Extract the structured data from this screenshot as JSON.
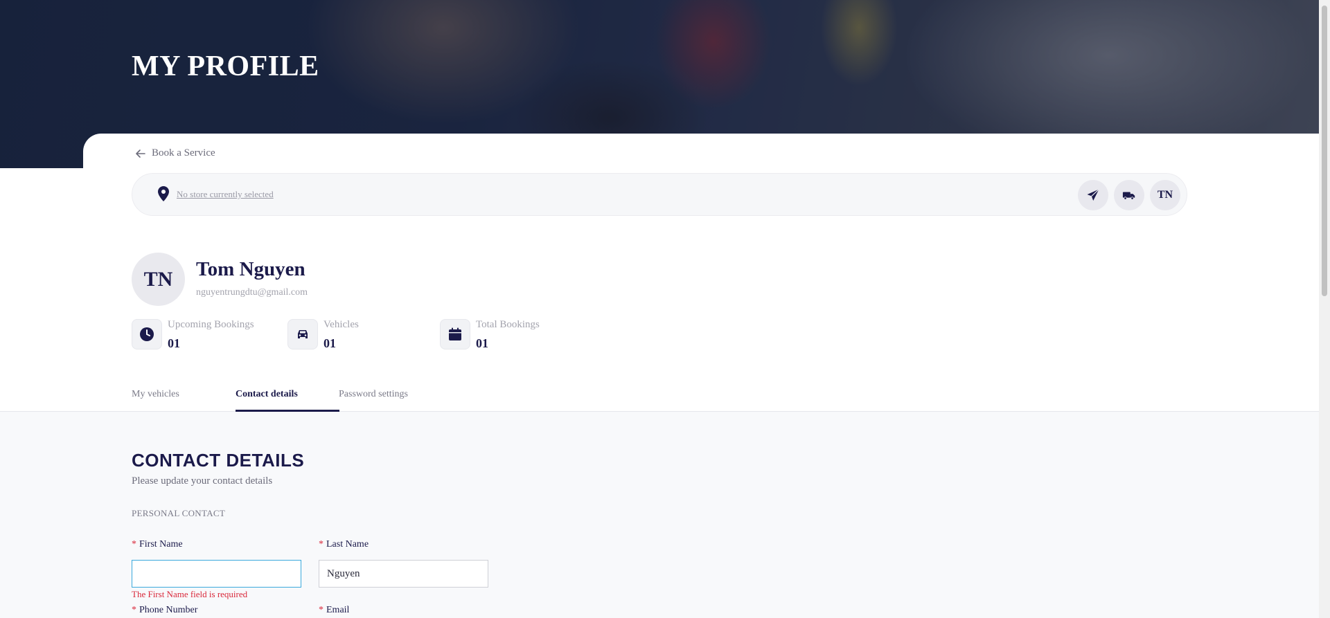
{
  "hero": {
    "title": "MY PROFILE"
  },
  "nav": {
    "back_label": "Book a Service"
  },
  "store_bar": {
    "store_text": "No store currently selected",
    "user_initials": "TN"
  },
  "profile": {
    "initials": "TN",
    "name": "Tom Nguyen",
    "email": "nguyentrungdtu@gmail.com",
    "stats": [
      {
        "label": "Upcoming Bookings",
        "value": "01",
        "icon": "clock-icon"
      },
      {
        "label": "Vehicles",
        "value": "01",
        "icon": "car-icon"
      },
      {
        "label": "Total Bookings",
        "value": "01",
        "icon": "calendar-icon"
      }
    ]
  },
  "tabs": [
    {
      "label": "My vehicles"
    },
    {
      "label": "Contact details",
      "active": true
    },
    {
      "label": "Password settings"
    }
  ],
  "contact": {
    "title": "CONTACT DETAILS",
    "subtitle": "Please update your contact details",
    "group_label": "PERSONAL CONTACT",
    "required_marker": "*",
    "first_name": {
      "label": "First Name",
      "value": "",
      "error": "The First Name field is required"
    },
    "last_name": {
      "label": "Last Name",
      "value": "Nguyen"
    },
    "phone": {
      "label": "Phone Number"
    },
    "email": {
      "label": "Email"
    }
  },
  "colors": {
    "primary": "#1b1a4a",
    "error": "#d9283a",
    "focus": "#39a9dc",
    "section_bg": "#f8f9fb"
  }
}
